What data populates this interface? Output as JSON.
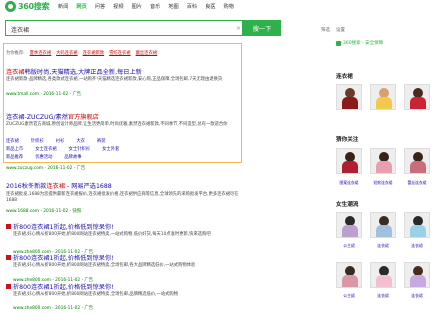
{
  "logo": "360搜索",
  "nav": [
    "新闻",
    "网页",
    "问答",
    "视频",
    "图片",
    "音乐",
    "地图",
    "百科",
    "良医",
    "购物"
  ],
  "search": {
    "value": "连衣裙",
    "button": "搜一下",
    "clear": "×"
  },
  "result_count": "相关结果约100,000,000个",
  "filter_tools": [
    "筛选",
    "设置"
  ],
  "guess": {
    "label": "为你推荐:",
    "tags": [
      "夏季连衣裙",
      "大码连衣裙",
      "连衣裙新款",
      "雪纺连衣裙",
      "蕾丝连衣裙"
    ]
  },
  "ad1": {
    "title_pre": "连衣裙",
    "title_post": "韩版时尚,天猫精选,大牌正品全新,每日上新",
    "desc": "连衣裙新款-品牌精选,各类款式连衣裙,一站购齐!天猫精选连衣裙新款,安心购,正品保障,全场包邮,7天无理由退换货",
    "url": "www.tmall.com - 2016-11-02 - 广告"
  },
  "ad2": {
    "title_pre": "连衣裙-ZUCZUG/素然",
    "title_post": "官方旗舰店",
    "desc": "ZUCZUG素然官方商城,原创设计师品牌,让生活更简单,时尚优雅,素然连衣裙新款,不同季节,不同造型,总有一款适合你",
    "sitelinks_row1": [
      "连衣裙",
      "针织衫",
      "衬衫",
      "大衣",
      "裤装"
    ],
    "sitelinks_row2": [
      "新品上市",
      "女士连衣裙",
      "女士针织衫",
      "女士外套"
    ],
    "sitelinks_row3": [
      "新品推荐",
      "优惠活动",
      "品牌故事"
    ],
    "url": "www.zuczug.com - 2016-11-02 - 广告"
  },
  "organic": {
    "title_pre": "2016秋冬新款",
    "title_hl": "连衣裙",
    "title_post": " - 网易严选1688",
    "desc": "连衣裙批发,1688为您提供最新连衣裙报价,连衣裙批发价格,连衣裙供应商等信息,全球领先的采购批发平台,更多连衣裙尽在1688",
    "url": "www.1688.com - 2016-11-02 - 快照"
  },
  "ad_items": [
    {
      "title": "折800连衣裙1折起,价格低到惊呆你!",
      "desc": "连衣裙,好心情从折800开始,折800网站连衣裙特卖,一站式购物,低价好货,每天10点准时更新,快来选购吧",
      "url": "www.zhe800.com - 2016-11-02 - 广告"
    },
    {
      "title": "折800连衣裙1折起,价格低到惊呆你!",
      "desc": "连衣裙,好心情从折800开始,折800网站连衣裙特卖,全场包邮,各大品牌精选低价,一站式购物体验",
      "url": "www.zhe800.com - 2016-11-02 - 广告"
    },
    {
      "title": "折800连衣裙1折起,价格低到惊呆你!",
      "desc": "连衣裙,好心情从折800开始,折800网站连衣裙特卖,全场包邮,品牌精选低价,一站式购物",
      "url": "www.zhe800.com - 2016-11-02 - 广告"
    }
  ],
  "right": {
    "header": "360搜索 - 安全保障",
    "sections": [
      {
        "title": "连衣裙",
        "items": [
          "",
          "",
          ""
        ]
      },
      {
        "title": "猜你关注",
        "items": [
          "图案连衣裙",
          "短款连衣裙",
          "蕾丝连衣裙"
        ]
      },
      {
        "title": "女生潮流",
        "items": [
          "公主裙",
          "连衣裙",
          "连衣裙"
        ]
      },
      {
        "title": "",
        "items": [
          "公主裙",
          "连衣裙",
          "连衣裙"
        ]
      }
    ]
  },
  "colors": {
    "brand": "#2eb14b",
    "link": "#1a0dab",
    "highlight": "#cc0000",
    "url": "#008000",
    "adbox": "#f5b84c"
  }
}
